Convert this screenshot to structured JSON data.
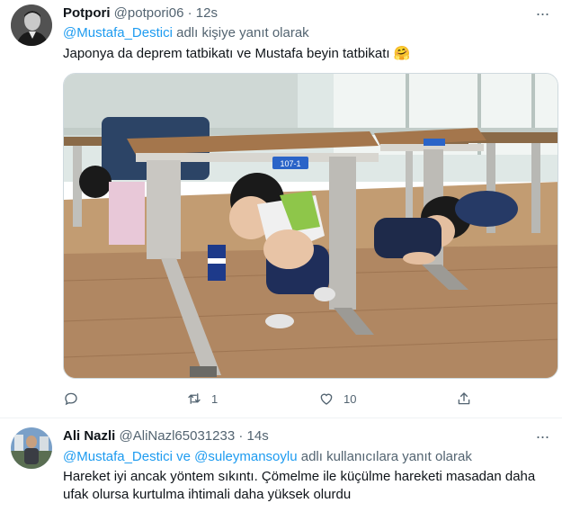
{
  "tweet1": {
    "display_name": "Potpori",
    "handle": "@potpori06",
    "separator": "·",
    "time": "12s",
    "more_glyph": "···",
    "reply_mention": "@Mustafa_Destici",
    "reply_suffix": " adlı kişiye yanıt olarak",
    "text": "Japonya da deprem tatbikatı ve Mustafa beyin tatbikatı",
    "emoji": "🤗",
    "image_alt": "Japanese children crouching under school desks during an earthquake drill",
    "desk_tag_label": "107-1",
    "retweet_count": "1",
    "like_count": "10"
  },
  "tweet2": {
    "display_name": "Ali Nazli",
    "handle": "@AliNazl65031233",
    "separator": "·",
    "time": "14s",
    "more_glyph": "···",
    "reply_mention_1": "@Mustafa_Destici",
    "reply_conj": " ve ",
    "reply_mention_2": "@suleymansoylu",
    "reply_suffix": " adlı kullanıcılara yanıt olarak",
    "text_line1": "Hareket iyi ancak yöntem sıkıntı. Çömelme ile küçülme hareketi masadan daha",
    "text_line2": "ufak olursa kurtulma ihtimali daha yüksek olurdu"
  },
  "icons": {
    "reply": "reply-icon",
    "retweet": "retweet-icon",
    "like": "heart-icon",
    "share": "share-icon",
    "more": "more-icon"
  },
  "colors": {
    "link": "#1d9bf0",
    "muted": "#536471",
    "text": "#0f1419",
    "divider": "#eff3f4"
  }
}
